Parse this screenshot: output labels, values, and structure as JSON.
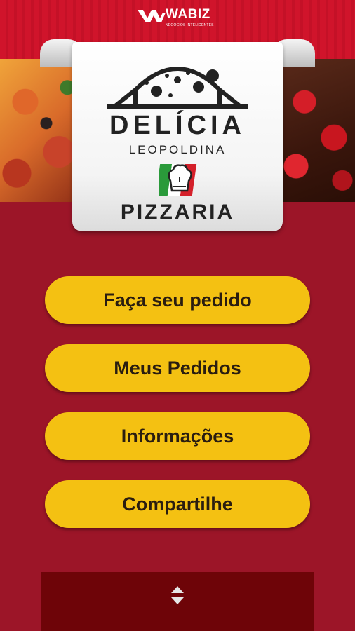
{
  "app": {
    "vendor_name": "WABIZ",
    "vendor_tagline": "NEGÓCIOS INTELIGENTES"
  },
  "logo": {
    "title": "DELÍCIA",
    "subtitle": "LEOPOLDINA",
    "pizzaria": "PIZZARIA",
    "icon": "chef-hat-icon"
  },
  "menu": {
    "order_label": "Faça seu pedido",
    "my_orders_label": "Meus Pedidos",
    "info_label": "Informações",
    "share_label": "Compartilhe"
  },
  "colors": {
    "background": "#9c1528",
    "button": "#f4c112",
    "bottom_panel": "#6e0408"
  }
}
